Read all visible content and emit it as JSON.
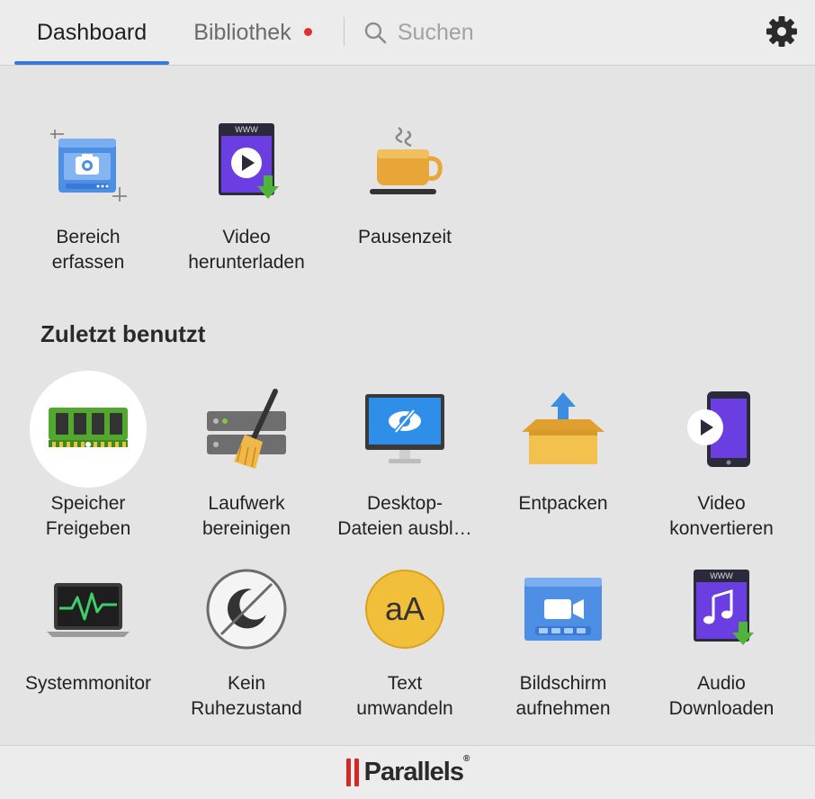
{
  "header": {
    "tabs": [
      {
        "label": "Dashboard",
        "active": true
      },
      {
        "label": "Bibliothek",
        "active": false,
        "badge": "red-dot"
      }
    ],
    "search": {
      "placeholder": "Suchen",
      "value": ""
    },
    "settings_icon": "gear-icon"
  },
  "main": {
    "featured": [
      {
        "label": "Bereich\nerfassen",
        "icon": "capture-area-icon"
      },
      {
        "label": "Video\nherunterladen",
        "icon": "download-video-icon"
      },
      {
        "label": "Pausenzeit",
        "icon": "coffee-cup-icon"
      }
    ],
    "recent_title": "Zuletzt benutzt",
    "recent": [
      {
        "label": "Speicher\nFreigeben",
        "icon": "memory-ram-icon",
        "highlighted": true
      },
      {
        "label": "Laufwerk\nbereinigen",
        "icon": "drive-broom-icon"
      },
      {
        "label": "Desktop-\nDateien ausbl…",
        "icon": "hide-desktop-icon"
      },
      {
        "label": "Entpacken",
        "icon": "unarchive-box-icon"
      },
      {
        "label": "Video\nkonvertieren",
        "icon": "convert-video-icon"
      },
      {
        "label": "Systemmonitor",
        "icon": "system-monitor-icon"
      },
      {
        "label": "Kein\nRuhezustand",
        "icon": "no-sleep-icon"
      },
      {
        "label": "Text\numwandeln",
        "icon": "text-convert-icon"
      },
      {
        "label": "Bildschirm\naufnehmen",
        "icon": "screen-record-icon"
      },
      {
        "label": "Audio\nDownloaden",
        "icon": "download-audio-icon"
      }
    ]
  },
  "footer": {
    "brand": "Parallels",
    "trademark": "®"
  },
  "colors": {
    "accent": "#3a78d6",
    "badge": "#e0302b",
    "brand_red": "#d42a27",
    "background": "#e4e4e4"
  }
}
